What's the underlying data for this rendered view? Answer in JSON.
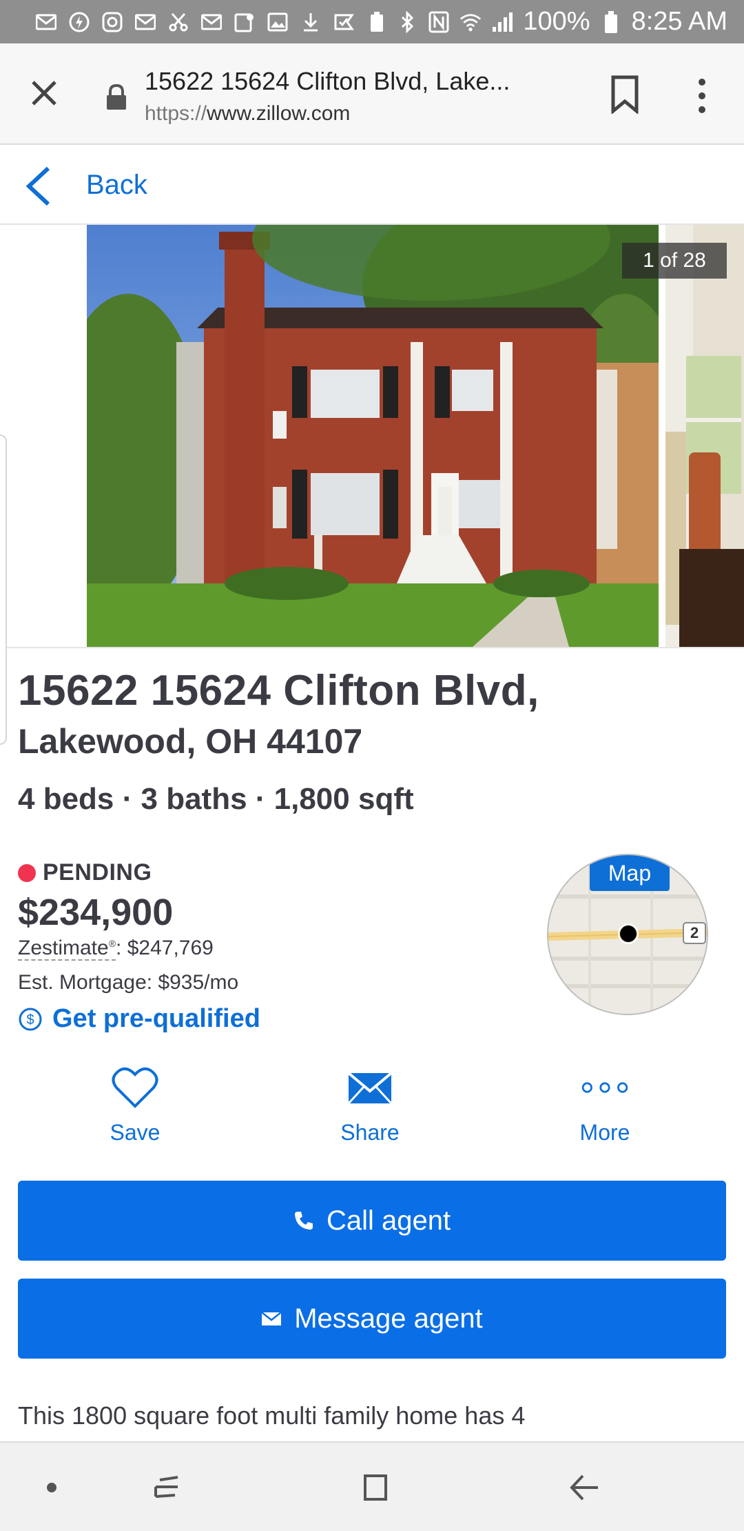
{
  "status_bar": {
    "battery": "100%",
    "time": "8:25 AM"
  },
  "browser": {
    "page_title": "15622 15624 Clifton Blvd, Lake...",
    "url_scheme": "https://",
    "url_host": "www.zillow.com"
  },
  "nav": {
    "back_label": "Back"
  },
  "gallery": {
    "counter": "1 of 28"
  },
  "listing": {
    "address_line1": "15622 15624 Clifton Blvd,",
    "address_line2": "Lakewood, OH 44107",
    "facts": "4 beds · 3 baths · 1,800 sqft",
    "status": "PENDING",
    "price": "$234,900",
    "zestimate_label": "Zestimate",
    "zestimate_mark": "®",
    "zestimate_value": ": $247,769",
    "mortgage": "Est. Mortgage: $935/mo",
    "prequal_label": "Get pre-qualified",
    "map_label": "Map",
    "map_road_number": "2"
  },
  "actions": {
    "save": "Save",
    "share": "Share",
    "more": "More"
  },
  "buttons": {
    "call_agent": "Call agent",
    "message_agent": "Message agent"
  },
  "description": "This 1800 square foot multi family home has 4",
  "colors": {
    "accent": "#0a6ee6",
    "link": "#0e6fd6",
    "status_dot": "#f0344f",
    "status_bar": "#8f8f8f"
  }
}
